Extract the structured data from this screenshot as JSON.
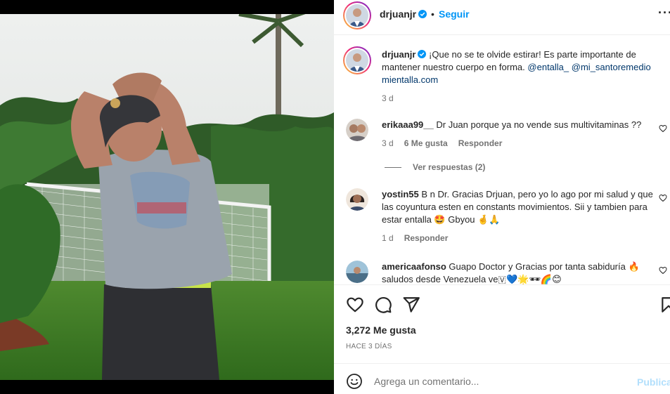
{
  "post": {
    "username": "drjuanjr",
    "dot": "•",
    "follow_label": "Seguir",
    "more_label": "···",
    "caption_text": "¡Que no se te olvide estirar! Es parte importante de mantener nuestro cuerpo en forma.",
    "mention_1": "@entalla_",
    "mention_2": "@mi_santoremedio",
    "link_text": "mientalla.com",
    "caption_time": "3 d",
    "likes": "3,272 Me gusta",
    "posted_ago": "HACE 3 DÍAS"
  },
  "comments": [
    {
      "username": "erikaaa99__",
      "text": "Dr Juan porque ya no vende sus multivitaminas ??",
      "time": "3 d",
      "likes": "6 Me gusta",
      "reply_label": "Responder",
      "view_replies": "Ver respuestas (2)"
    },
    {
      "username": "yostin55",
      "text": "B n Dr. Gracias Drjuan, pero yo lo ago por mi salud y que las coyuntura esten en constants movimientos. Sii y tambien para estar entalla 🤩 Gbyou 🤞🙏",
      "time": "1 d",
      "reply_label": "Responder"
    },
    {
      "username": "americaafonso",
      "text": "Guapo Doctor y Gracias por tanta sabiduría 🔥 saludos desde Venezuela ve🇻💙🌟🕶🌈😊"
    }
  ],
  "add_comment": {
    "placeholder": "Agrega un comentario...",
    "publish_label": "Publicar"
  },
  "colors": {
    "accent": "#0095f6",
    "link": "#00376b",
    "muted": "#737373",
    "publish_disabled": "#b2dffc"
  },
  "icons": [
    "heart-icon",
    "comment-icon",
    "share-icon",
    "bookmark-icon",
    "emoji-icon",
    "verified-badge-icon",
    "more-options-icon"
  ]
}
